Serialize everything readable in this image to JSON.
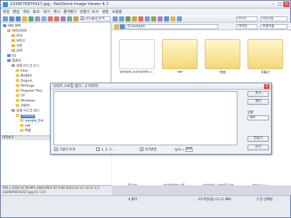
{
  "window": {
    "title": "1339076874317.jpg  -  FastStone Image Viewer 4.7"
  },
  "menu": [
    "파일",
    "편집",
    "색상",
    "효과",
    "보기",
    "태그",
    "즐겨찾기",
    "만들기",
    "도구",
    "설정",
    "도움말"
  ],
  "toolbar": {
    "smooth_label": "부드럽게",
    "zoom_value": "32%",
    "sort_value": "이미지",
    "view_value": "파일이름"
  },
  "tree": {
    "items": [
      {
        "label": "바탕 화면",
        "color": "#4a90d9"
      },
      {
        "label": "라이브러리",
        "color": "#e8b24a"
      },
      {
        "label": "문서",
        "color": "#e8b24a"
      },
      {
        "label": "비디오",
        "color": "#e8b24a"
      },
      {
        "label": "사진",
        "color": "#e8b24a"
      },
      {
        "label": "음악",
        "color": "#e8b24a"
      },
      {
        "label": "S1",
        "color": "#4a90d9"
      },
      {
        "label": "컴퓨터",
        "color": "#7a8ea8"
      },
      {
        "label": "로컬 디스크 (C:)",
        "color": "#9aa6b6"
      },
      {
        "label": "Intel",
        "color": "#f0c64e"
      },
      {
        "label": "NVIDIA",
        "color": "#f0c64e"
      },
      {
        "label": "Output",
        "color": "#f0c64e"
      },
      {
        "label": "PerfLogs",
        "color": "#f0c64e"
      },
      {
        "label": "Program Files",
        "color": "#f0c64e"
      },
      {
        "label": "UT",
        "color": "#f0c64e"
      },
      {
        "label": "Windows",
        "color": "#f0c64e"
      },
      {
        "label": "사용자",
        "color": "#f0c64e"
      },
      {
        "label": "로컬 디스크 (D:)",
        "color": "#9aa6b6"
      },
      {
        "label": "sample",
        "color": "#f0c64e"
      },
      {
        "label": "sample_Ext",
        "color": "#f0c64e"
      },
      {
        "label": "swf",
        "color": "#f0c64e"
      },
      {
        "label": "엑셀",
        "color": "#f0c64e"
      }
    ]
  },
  "preview_header": "미리보기",
  "path": {
    "value": "D:\\sample\\",
    "type_filter": "이미지",
    "sort": "파일이름"
  },
  "thumbnails": [
    {
      "label": "sample_Extracted_l...",
      "kind": "doc"
    },
    {
      "label": "swf",
      "kind": "folder"
    },
    {
      "label": "엑셀",
      "kind": "folder"
    },
    {
      "label": "프롤기",
      "kind": "folder"
    }
  ],
  "thumbnails_bottom": [
    "4t.jpg",
    "animation.gif",
    "sample - page2.jpg",
    "전보오.jpg"
  ],
  "status": {
    "info_line": "765 x 1024 (0.78 MP)  24bit  JPEG  87.6 KB  2013-01-31 15:11  1:1",
    "file_line": "1339076874317.jpg [5 / 13]",
    "folders": "4 폴더",
    "files": "13 파일(들) (1.11 MB)",
    "selected": "1 장 선택됨"
  },
  "dialog": {
    "title": "이미지 스트립 빌더 - 2 이미지",
    "buttons": {
      "add": "추가",
      "remove": "제거",
      "create": "만들기",
      "close": "닫기"
    },
    "direction_label": "방향",
    "direction_value": "세로",
    "options": {
      "shadow": "그림자 효과",
      "numbering": "1, 2, 3 ...",
      "resize": "크기변경",
      "height_label": "높이 =",
      "height_value": "400"
    }
  }
}
